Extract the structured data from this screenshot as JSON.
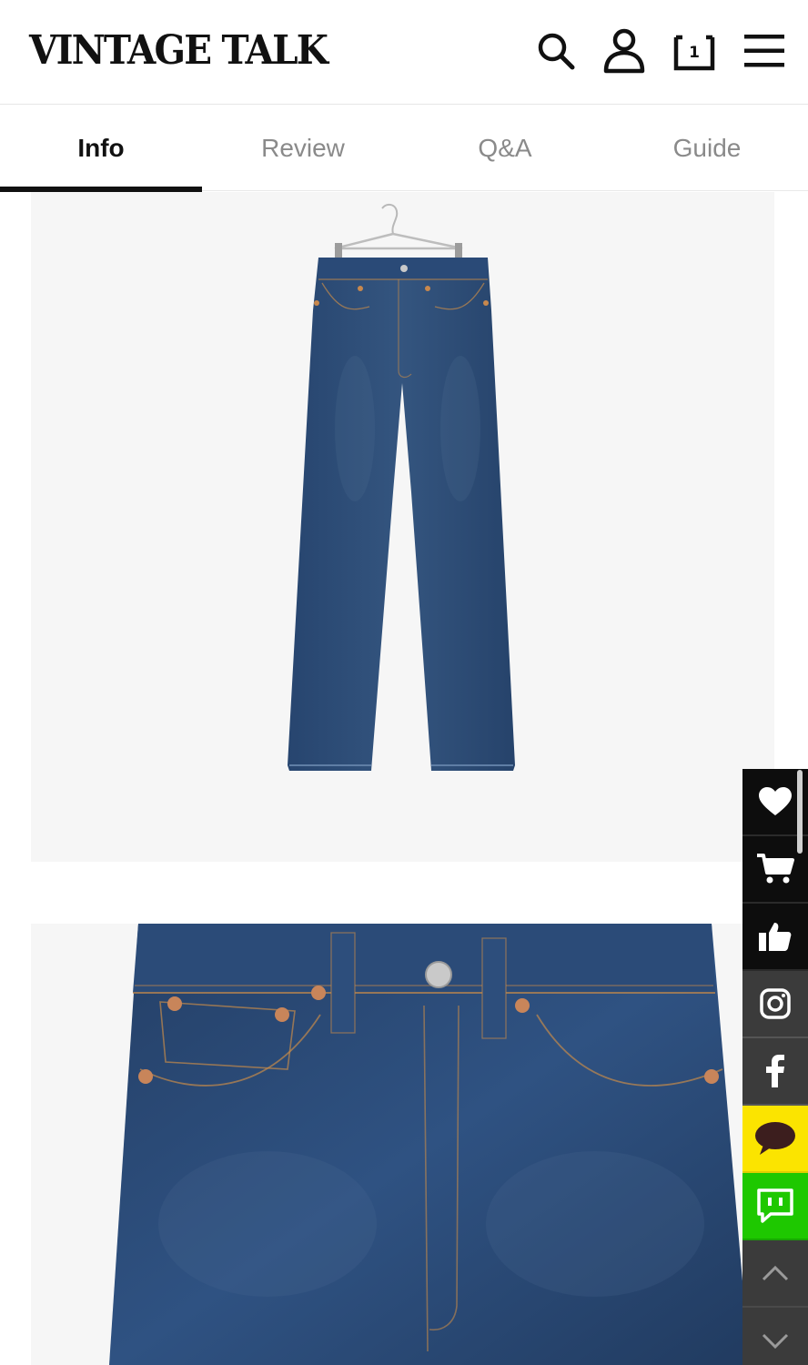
{
  "header": {
    "logo": "VINTAGE TALK",
    "bag_count": "1",
    "icons": [
      "search-icon",
      "user-icon",
      "bag-icon",
      "menu-icon"
    ]
  },
  "tabs": [
    {
      "label": "Info",
      "active": true
    },
    {
      "label": "Review",
      "active": false
    },
    {
      "label": "Q&A",
      "active": false
    },
    {
      "label": "Guide",
      "active": false
    }
  ],
  "images": [
    "full-length jeans product photo",
    "jeans waistband close-up photo"
  ],
  "sidebar": {
    "items": [
      "heart-icon",
      "cart-icon",
      "thumbs-up-icon",
      "instagram-icon",
      "facebook-icon",
      "kakaotalk-icon",
      "talktalk-icon",
      "chevron-up-icon",
      "chevron-down-icon"
    ]
  },
  "colors": {
    "accent": "#111111",
    "tab_inactive": "#8a8a8a",
    "kakao_yellow": "#fbe400",
    "naver_green": "#1ec800",
    "denim": "#2f4f7d"
  }
}
